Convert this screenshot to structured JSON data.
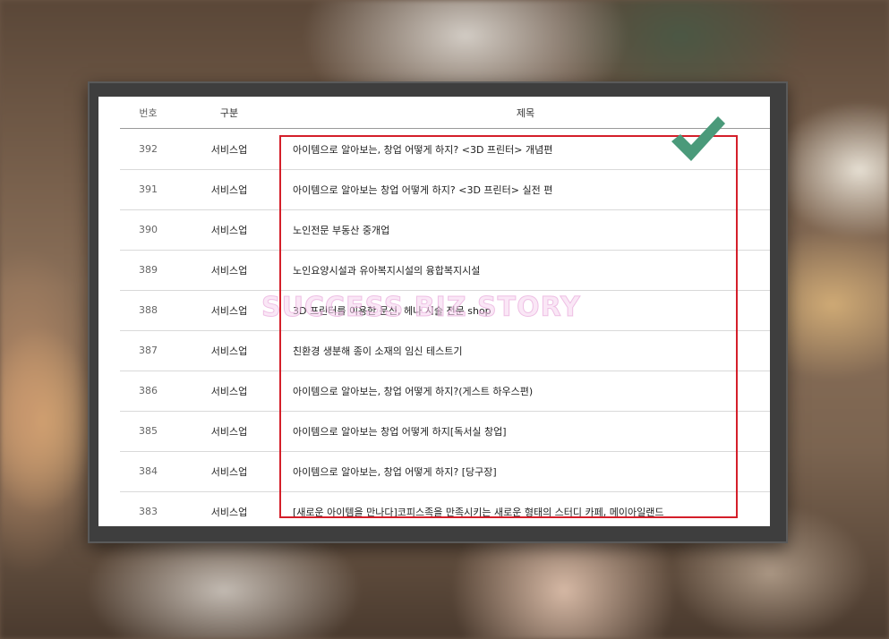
{
  "header": {
    "num": "번호",
    "category": "구분",
    "title": "제목"
  },
  "rows": [
    {
      "num": "392",
      "category": "서비스업",
      "title": "아이템으로 알아보는, 창업 어떻게 하지? <3D 프린터> 개념편"
    },
    {
      "num": "391",
      "category": "서비스업",
      "title": "아이템으로 알아보는 창업 어떻게 하지? <3D 프린터> 실전 편"
    },
    {
      "num": "390",
      "category": "서비스업",
      "title": "노인전문 부동산 중개업"
    },
    {
      "num": "389",
      "category": "서비스업",
      "title": "노인요양시설과 유아복지시설의 융합복지시설"
    },
    {
      "num": "388",
      "category": "서비스업",
      "title": "3D 프린터를 이용한 문신, 헤나 시술 전문 shop"
    },
    {
      "num": "387",
      "category": "서비스업",
      "title": "친환경 생분해 종이 소재의 임신 테스트기"
    },
    {
      "num": "386",
      "category": "서비스업",
      "title": "아이템으로 알아보는, 창업 어떻게 하지?(게스트 하우스편)"
    },
    {
      "num": "385",
      "category": "서비스업",
      "title": "아이템으로 알아보는 창업 어떻게 하지[독서실 창업]"
    },
    {
      "num": "384",
      "category": "서비스업",
      "title": "아이템으로 알아보는, 창업 어떻게 하지? [당구장]"
    },
    {
      "num": "383",
      "category": "서비스업",
      "title": "[새로운 아이템을 만나다]코피스족을 만족시키는 새로운 형태의 스터디 카페, 메이아일랜드"
    }
  ],
  "watermark": "SUCCESS BIZ STORY",
  "colors": {
    "highlight": "#d41f2a",
    "check": "#4a9a7a"
  },
  "icons": {
    "check": "check-mark-icon"
  }
}
